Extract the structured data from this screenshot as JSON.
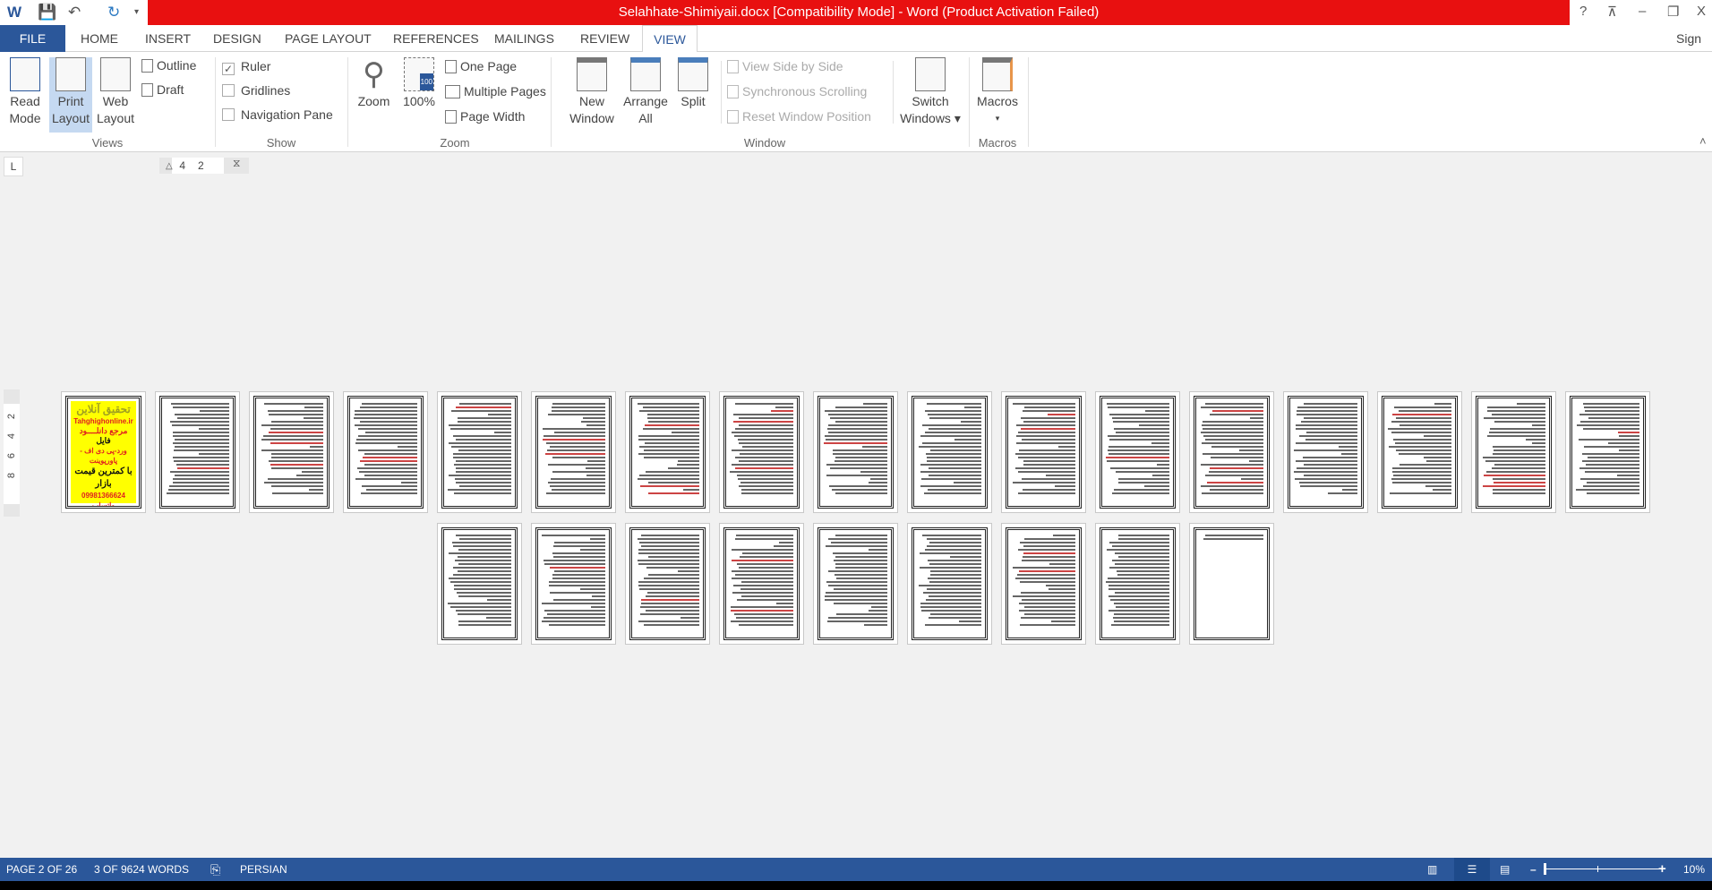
{
  "title": "Selahhate-Shimiyaii.docx [Compatibility Mode] -  Word (Product Activation Failed)",
  "window_controls": {
    "help": "?",
    "restore_ribbon": "⊼",
    "minimize": "–",
    "maximize": "❐",
    "close": "X"
  },
  "sign_in": "Sign in",
  "tabs": [
    "FILE",
    "HOME",
    "INSERT",
    "DESIGN",
    "PAGE LAYOUT",
    "REFERENCES",
    "MAILINGS",
    "REVIEW",
    "VIEW"
  ],
  "active_tab": "VIEW",
  "ribbon": {
    "views": {
      "label": "Views",
      "read_mode": [
        "Read",
        "Mode"
      ],
      "print_layout": [
        "Print",
        "Layout"
      ],
      "web_layout": [
        "Web",
        "Layout"
      ],
      "outline": "Outline",
      "draft": "Draft"
    },
    "show": {
      "label": "Show",
      "ruler": "Ruler",
      "ruler_checked": true,
      "gridlines": "Gridlines",
      "gridlines_checked": false,
      "navigation_pane": "Navigation Pane",
      "navigation_pane_checked": false
    },
    "zoom": {
      "label": "Zoom",
      "zoom": "Zoom",
      "hundred": "100%",
      "one_page": "One Page",
      "multiple_pages": "Multiple Pages",
      "page_width": "Page Width"
    },
    "window": {
      "label": "Window",
      "new_window": [
        "New",
        "Window"
      ],
      "arrange_all": [
        "Arrange",
        "All"
      ],
      "split": "Split",
      "view_side_by_side": "View Side by Side",
      "synchronous_scrolling": "Synchronous Scrolling",
      "reset_window_position": "Reset Window Position",
      "switch_windows": [
        "Switch",
        "Windows ▾"
      ]
    },
    "macros": {
      "label": "Macros",
      "macros": "Macros",
      "arrow": "▾"
    }
  },
  "ruler": {
    "tab_selector": "L",
    "numbers": [
      "4",
      "2"
    ],
    "vertical_numbers": [
      "2",
      "4",
      "6",
      "8"
    ]
  },
  "cover_page": {
    "lines": [
      "تحقیق آنلاین",
      "Tahghighonline.ir",
      "مرجع دانلــــود",
      "فایل",
      "ورد-پی دی اف - پاورپوینت",
      "با کمترین قیمت بازار",
      "09981366624 واتساپ"
    ],
    "bg": "#ffff00"
  },
  "total_thumbnails": 26,
  "status": {
    "page": "PAGE 2 OF 26",
    "words": "3 OF 9624 WORDS",
    "language": "PERSIAN",
    "zoom": "10%",
    "zoom_percent": 10
  },
  "colors": {
    "title_bar": "#e81010",
    "accent": "#2b579a",
    "selected": "#c5d9f1"
  }
}
